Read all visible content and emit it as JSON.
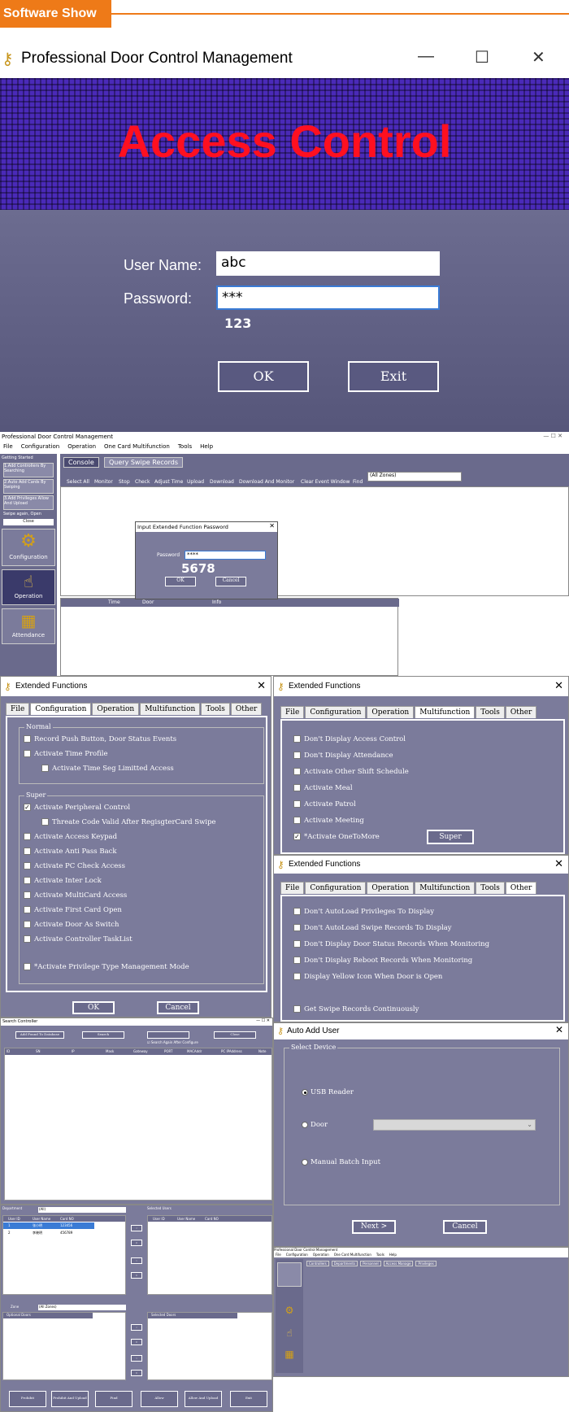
{
  "header": {
    "tag": "Software Show"
  },
  "login": {
    "title": "Professional Door Control Management",
    "banner": "Access Control",
    "user_label": "User Name:",
    "user_value": "abc",
    "pass_label": "Password:",
    "pass_value": "***",
    "pass_hint": "123",
    "ok": "OK",
    "exit": "Exit"
  },
  "main": {
    "title": "Professional Door Control Management",
    "menu": [
      "File",
      "Configuration",
      "Operation",
      "One Card Multifunction",
      "Tools",
      "Help"
    ],
    "getting_started": "Getting Started",
    "steps": [
      "1.Add Controllers By Searching",
      "2.Auto Add Cards By Swiping",
      "3.Add Privileges Allow And Upload",
      "Swipe again, Open"
    ],
    "close": "Close",
    "nav": [
      "Configuration",
      "Operation",
      "Attendance"
    ],
    "tabs": [
      "Console",
      "Query Swipe Records"
    ],
    "toolbar": [
      "Select All",
      "Monitor",
      "Stop",
      "Check",
      "Adjust Time",
      "Upload",
      "Download",
      "Download And Monitor",
      "Clear Event Window",
      "Find"
    ],
    "zones": "(All Zones)",
    "cols": [
      "Time",
      "Door",
      "Info"
    ]
  },
  "pwd_dialog": {
    "title": "Input Extended Function Password",
    "label": "Password",
    "value": "****",
    "hint": "5678",
    "ok": "OK",
    "cancel": "Cancel"
  },
  "ext1": {
    "title": "Extended Functions",
    "tabs": [
      "File",
      "Configuration",
      "Operation",
      "Multifunction",
      "Tools",
      "Other"
    ],
    "normal": "Normal",
    "normal_items": [
      "Record Push Button, Door Status Events",
      "Activate Time Profile",
      "Activate Time Seg Limitted Access"
    ],
    "super": "Super",
    "super_items": [
      "Activate Peripheral Control",
      "Threate Code Valid After RegisgterCard Swipe",
      "Activate Access Keypad",
      "Activate Anti Pass Back",
      "Activate PC Check Access",
      "Activate Inter Lock",
      "Activate MultiCard Access",
      "Activate First Card Open",
      "Activate Door As Switch",
      "Activate Controller TaskList"
    ],
    "privilege": "*Activate Privilege Type Management Mode",
    "ok": "OK",
    "cancel": "Cancel"
  },
  "ext2": {
    "title": "Extended Functions",
    "tabs": [
      "File",
      "Configuration",
      "Operation",
      "Multifunction",
      "Tools",
      "Other"
    ],
    "items": [
      "Don't Display Access Control",
      "Don't Display Attendance",
      "Activate Other Shift Schedule",
      "Activate Meal",
      "Activate Patrol",
      "Activate Meeting",
      "*Activate OneToMore"
    ],
    "super_btn": "Super"
  },
  "ext3": {
    "title": "Extended Functions",
    "tabs": [
      "File",
      "Configuration",
      "Operation",
      "Multifunction",
      "Tools",
      "Other"
    ],
    "items": [
      "Don't AutoLoad Privileges To Display",
      "Don't AutoLoad Swipe Records To Display",
      "Don't Display Door Status Records When Monitoring",
      "Don't Display Reboot Records When Monitoring",
      "Display Yellow Icon When Door is Open",
      "Get Swipe Records Continuously"
    ]
  },
  "search": {
    "title": "Search Controller",
    "add": "Add Found To Database",
    "search": "Search",
    "close": "Close",
    "again": "Search Again After Configure",
    "cols": [
      "ID",
      "SN",
      "IP",
      "Mask",
      "Gateway",
      "PORT",
      "MACAddr",
      "PC IPAddress",
      "Note"
    ]
  },
  "auto_add": {
    "title": "Auto Add User",
    "group": "Select Device",
    "usb": "USB Reader",
    "door": "Door",
    "manual": "Manual Batch Input",
    "next": "Next >",
    "cancel": "Cancel"
  },
  "priv": {
    "dept_label": "Department",
    "dept": "(All)",
    "cols_left": [
      "User ID",
      "User Name",
      "Card NO"
    ],
    "rows": [
      [
        "1",
        "张小明",
        "123456"
      ],
      [
        "2",
        "李晓明",
        "456789"
      ]
    ],
    "selected": "Selected Users",
    "cols_right": [
      "User ID",
      "User Name",
      "Card NO"
    ],
    "zone_label": "Zone",
    "zone": "(All Zones)",
    "optional": "Optional Doors",
    "selected_doors": "Selected Doors",
    "buttons": [
      "Prohibit",
      "Prohibit And Upload",
      "Find",
      "Allow",
      "Allow And Upload",
      "Exit"
    ]
  },
  "mini": {
    "title": "Professional Door Control Management",
    "menu": [
      "File",
      "Configuration",
      "Operation",
      "One Card Multifunction",
      "Tools",
      "Help"
    ],
    "tabs": [
      "Controllers",
      "Departments",
      "Personnel",
      "Access Manage",
      "Privileges"
    ]
  },
  "colors": {
    "orange": "#ee7a18",
    "panel": "#7b7b9b",
    "banner_red": "#ff1020",
    "banner_blue": "#4a2ab8"
  }
}
